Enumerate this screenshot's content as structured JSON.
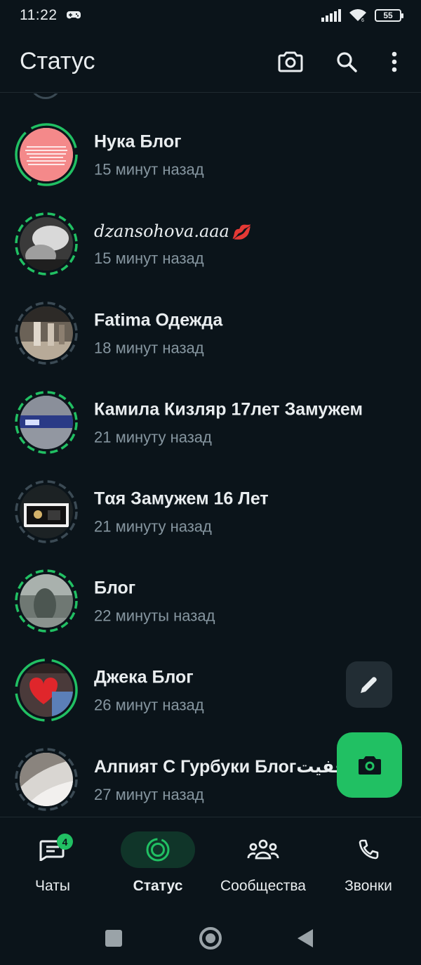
{
  "status_bar": {
    "time": "11:22",
    "battery": "55"
  },
  "header": {
    "title": "Статус",
    "icons": [
      "camera-icon",
      "search-icon",
      "more-vert-icon"
    ]
  },
  "statuses": [
    {
      "name": "Нука Блог",
      "time": "15 минут назад",
      "ring": "green"
    },
    {
      "name": "dzansohova.aaa",
      "time": "15 минут назад",
      "ring": "green",
      "emoji": "💋"
    },
    {
      "name": "Fatima Одежда",
      "time": "18 минут назад",
      "ring": "gray"
    },
    {
      "name": "Камила Кизляр 17лет Замужем",
      "time": "21 минуту назад",
      "ring": "green"
    },
    {
      "name": "Тαя Замужем 16 Лет",
      "time": "21 минуту назад",
      "ring": "gray"
    },
    {
      "name": "Блог",
      "time": "22 минуты назад",
      "ring": "green"
    },
    {
      "name": "Джека Блог",
      "time": "26 минут назад",
      "ring": "green"
    },
    {
      "name": "Алпият С Гурбуки Блогعفيت",
      "time": "27 минут назад",
      "ring": "gray"
    }
  ],
  "bottom_nav": {
    "items": [
      {
        "label": "Чаты",
        "icon": "chats-icon",
        "badge": "4"
      },
      {
        "label": "Статус",
        "icon": "status-icon",
        "active": true
      },
      {
        "label": "Сообщества",
        "icon": "communities-icon"
      },
      {
        "label": "Звонки",
        "icon": "calls-icon"
      }
    ]
  },
  "colors": {
    "background": "#0b141a",
    "accent": "#21c063",
    "secondary_text": "#8696a0",
    "viewed_ring": "#3b4a54"
  }
}
